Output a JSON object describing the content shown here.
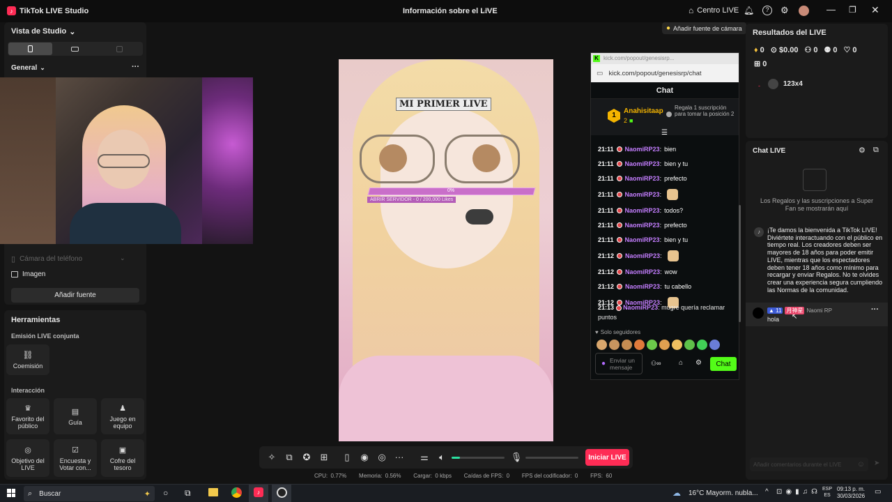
{
  "titlebar": {
    "app_title": "TikTok LIVE Studio",
    "center_title": "Información sobre el LIVE",
    "centro_live": "Centro LIVE"
  },
  "left": {
    "studio_view": "Vista de Studio",
    "section_general": "General",
    "source_phone_camera": "Cámara del teléfono",
    "source_image": "Imagen",
    "add_source": "Añadir fuente",
    "tools_title": "Herramientas",
    "joint_emission": "Emisión LIVE conjunta",
    "coemission": "Coemisión",
    "interaction": "Interacción",
    "tools": [
      {
        "label": "Favorito del público",
        "icon": "fan-icon"
      },
      {
        "label": "Guía",
        "icon": "guide-icon"
      },
      {
        "label": "Juego en equipo",
        "icon": "team-game-icon"
      },
      {
        "label": "Objetivo del LIVE",
        "icon": "goal-icon"
      },
      {
        "label": "Encuesta y Votar con...",
        "icon": "poll-icon"
      },
      {
        "label": "Cofre del tesoro",
        "icon": "treasure-icon"
      }
    ]
  },
  "canvas": {
    "add_camera_source": "Añadir fuente de cámara",
    "overlay_title": "MI PRIMER LIVE",
    "progress_percent": "0%",
    "progress_fraction": 0,
    "progress_label": "ABRIR SERVIDOR - 0 / 200,000 Likes"
  },
  "kick": {
    "url_faint": "kick.com/popout/genesisrp...",
    "url": "kick.com/popout/genesisrp/chat",
    "chat_title": "Chat",
    "pinned_user": "Anahisitaap",
    "pinned_rank": "1",
    "pinned_count": "2",
    "gift_text": "Regala 1 suscripción para tomar la posición 2",
    "messages": [
      {
        "time": "21:11",
        "user": "NaomiRP23",
        "text": "bien",
        "emoji": false
      },
      {
        "time": "21:11",
        "user": "NaomiRP23",
        "text": "bien y tu",
        "emoji": false
      },
      {
        "time": "21:11",
        "user": "NaomiRP23",
        "text": "prefecto",
        "emoji": false
      },
      {
        "time": "21:11",
        "user": "NaomiRP23",
        "text": "",
        "emoji": true
      },
      {
        "time": "21:11",
        "user": "NaomiRP23",
        "text": "todos?",
        "emoji": false
      },
      {
        "time": "21:11",
        "user": "NaomiRP23",
        "text": "prefecto",
        "emoji": false
      },
      {
        "time": "21:11",
        "user": "NaomiRP23",
        "text": "bien y tu",
        "emoji": false
      },
      {
        "time": "21:12",
        "user": "NaomiRP23",
        "text": "",
        "emoji": true
      },
      {
        "time": "21:12",
        "user": "NaomiRP23",
        "text": "wow",
        "emoji": false
      },
      {
        "time": "21:12",
        "user": "NaomiRP23",
        "text": "tu cabello",
        "emoji": false
      },
      {
        "time": "21:12",
        "user": "NaomiRP23",
        "text": "",
        "emoji": true
      }
    ],
    "last_time": "21:13",
    "last_user": "NaomiRP23",
    "last_text": "mugre quería reclamar puntos",
    "followers_only": "Solo seguidores",
    "input_placeholder": "Enviar un mensaje",
    "chat_button": "Chat"
  },
  "bottombar": {
    "start_live": "Iniciar LIVE",
    "volume_fraction": 0.16,
    "stats": "CPU:  0.77%        Memoria:  0.56%        Cargar:  0 kbps        Caídas de FPS:  0        FPS del codificador:  0        FPS:  60"
  },
  "results": {
    "title": "Resultados del LIVE",
    "diamonds": "0",
    "money": "$0.00",
    "viewers": "0",
    "followers": "0",
    "likes": "0",
    "gifts": "0",
    "top_user": "123x4"
  },
  "livechat": {
    "title": "Chat LIVE",
    "gifts_note": "Los Regalos y las suscripciones a Super Fan se mostrarán aquí",
    "welcome": "¡Te damos la bienvenida a TikTok LIVE! Diviértete interactuando con el público en tiempo real. Los creadores deben ser mayores de 18 años para poder emitir LIVE, mientras que los espectadores deben tener 18 años como mínimo para recargar y enviar Regalos. No te olvides crear una experiencia segura cumpliendo las Normas de la comunidad.",
    "msg_user": "Naomi RP",
    "msg_level": "11",
    "msg_badge": "月神星",
    "msg_text": "hola",
    "comment_placeholder": "Añadir comentarios durante el LIVE"
  },
  "taskbar": {
    "search": "Buscar",
    "weather": "16°C  Mayorm. nubla...",
    "lang_top": "ESP",
    "lang_bottom": "ES",
    "time": "09:13 p. m.",
    "date": "30/03/2026"
  },
  "colors": {
    "accent_pink": "#fe2c55",
    "kick_green": "#53fc18",
    "username_purple": "#c47eff"
  }
}
